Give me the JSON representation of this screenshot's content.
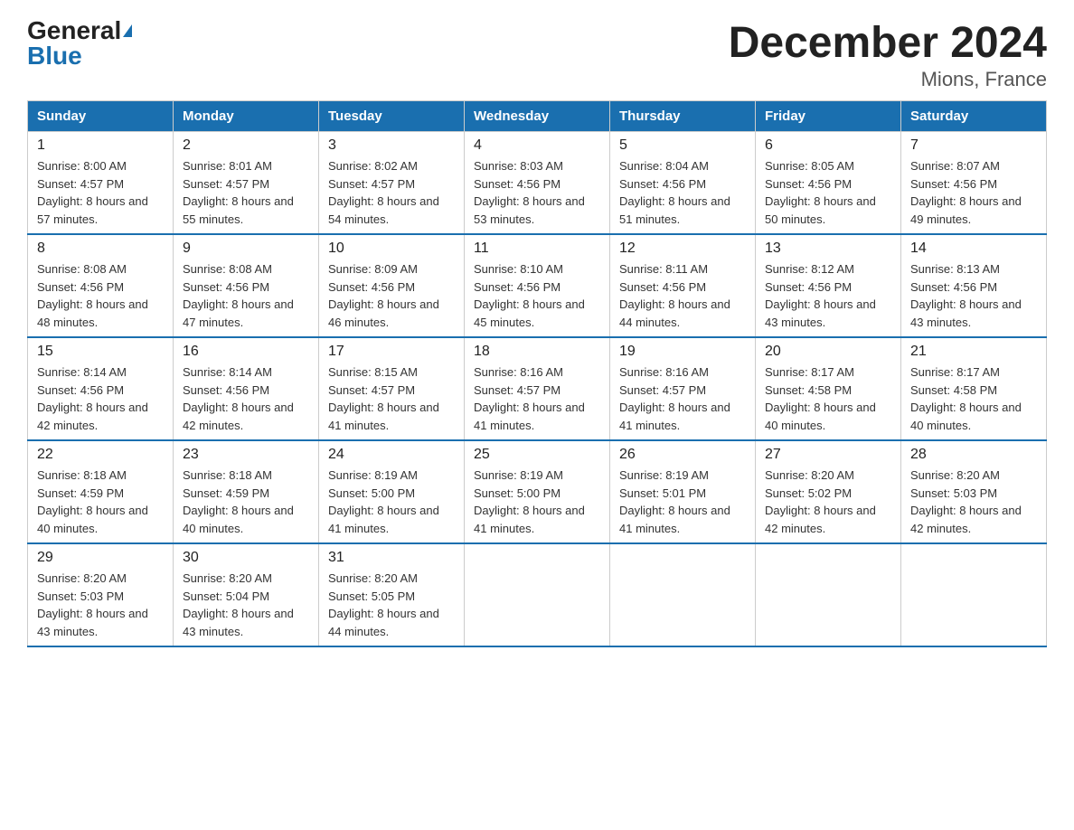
{
  "header": {
    "logo_general": "General",
    "logo_blue": "Blue",
    "month_title": "December 2024",
    "location": "Mions, France"
  },
  "weekdays": [
    "Sunday",
    "Monday",
    "Tuesday",
    "Wednesday",
    "Thursday",
    "Friday",
    "Saturday"
  ],
  "weeks": [
    [
      {
        "day": "1",
        "sunrise": "8:00 AM",
        "sunset": "4:57 PM",
        "daylight": "8 hours and 57 minutes."
      },
      {
        "day": "2",
        "sunrise": "8:01 AM",
        "sunset": "4:57 PM",
        "daylight": "8 hours and 55 minutes."
      },
      {
        "day": "3",
        "sunrise": "8:02 AM",
        "sunset": "4:57 PM",
        "daylight": "8 hours and 54 minutes."
      },
      {
        "day": "4",
        "sunrise": "8:03 AM",
        "sunset": "4:56 PM",
        "daylight": "8 hours and 53 minutes."
      },
      {
        "day": "5",
        "sunrise": "8:04 AM",
        "sunset": "4:56 PM",
        "daylight": "8 hours and 51 minutes."
      },
      {
        "day": "6",
        "sunrise": "8:05 AM",
        "sunset": "4:56 PM",
        "daylight": "8 hours and 50 minutes."
      },
      {
        "day": "7",
        "sunrise": "8:07 AM",
        "sunset": "4:56 PM",
        "daylight": "8 hours and 49 minutes."
      }
    ],
    [
      {
        "day": "8",
        "sunrise": "8:08 AM",
        "sunset": "4:56 PM",
        "daylight": "8 hours and 48 minutes."
      },
      {
        "day": "9",
        "sunrise": "8:08 AM",
        "sunset": "4:56 PM",
        "daylight": "8 hours and 47 minutes."
      },
      {
        "day": "10",
        "sunrise": "8:09 AM",
        "sunset": "4:56 PM",
        "daylight": "8 hours and 46 minutes."
      },
      {
        "day": "11",
        "sunrise": "8:10 AM",
        "sunset": "4:56 PM",
        "daylight": "8 hours and 45 minutes."
      },
      {
        "day": "12",
        "sunrise": "8:11 AM",
        "sunset": "4:56 PM",
        "daylight": "8 hours and 44 minutes."
      },
      {
        "day": "13",
        "sunrise": "8:12 AM",
        "sunset": "4:56 PM",
        "daylight": "8 hours and 43 minutes."
      },
      {
        "day": "14",
        "sunrise": "8:13 AM",
        "sunset": "4:56 PM",
        "daylight": "8 hours and 43 minutes."
      }
    ],
    [
      {
        "day": "15",
        "sunrise": "8:14 AM",
        "sunset": "4:56 PM",
        "daylight": "8 hours and 42 minutes."
      },
      {
        "day": "16",
        "sunrise": "8:14 AM",
        "sunset": "4:56 PM",
        "daylight": "8 hours and 42 minutes."
      },
      {
        "day": "17",
        "sunrise": "8:15 AM",
        "sunset": "4:57 PM",
        "daylight": "8 hours and 41 minutes."
      },
      {
        "day": "18",
        "sunrise": "8:16 AM",
        "sunset": "4:57 PM",
        "daylight": "8 hours and 41 minutes."
      },
      {
        "day": "19",
        "sunrise": "8:16 AM",
        "sunset": "4:57 PM",
        "daylight": "8 hours and 41 minutes."
      },
      {
        "day": "20",
        "sunrise": "8:17 AM",
        "sunset": "4:58 PM",
        "daylight": "8 hours and 40 minutes."
      },
      {
        "day": "21",
        "sunrise": "8:17 AM",
        "sunset": "4:58 PM",
        "daylight": "8 hours and 40 minutes."
      }
    ],
    [
      {
        "day": "22",
        "sunrise": "8:18 AM",
        "sunset": "4:59 PM",
        "daylight": "8 hours and 40 minutes."
      },
      {
        "day": "23",
        "sunrise": "8:18 AM",
        "sunset": "4:59 PM",
        "daylight": "8 hours and 40 minutes."
      },
      {
        "day": "24",
        "sunrise": "8:19 AM",
        "sunset": "5:00 PM",
        "daylight": "8 hours and 41 minutes."
      },
      {
        "day": "25",
        "sunrise": "8:19 AM",
        "sunset": "5:00 PM",
        "daylight": "8 hours and 41 minutes."
      },
      {
        "day": "26",
        "sunrise": "8:19 AM",
        "sunset": "5:01 PM",
        "daylight": "8 hours and 41 minutes."
      },
      {
        "day": "27",
        "sunrise": "8:20 AM",
        "sunset": "5:02 PM",
        "daylight": "8 hours and 42 minutes."
      },
      {
        "day": "28",
        "sunrise": "8:20 AM",
        "sunset": "5:03 PM",
        "daylight": "8 hours and 42 minutes."
      }
    ],
    [
      {
        "day": "29",
        "sunrise": "8:20 AM",
        "sunset": "5:03 PM",
        "daylight": "8 hours and 43 minutes."
      },
      {
        "day": "30",
        "sunrise": "8:20 AM",
        "sunset": "5:04 PM",
        "daylight": "8 hours and 43 minutes."
      },
      {
        "day": "31",
        "sunrise": "8:20 AM",
        "sunset": "5:05 PM",
        "daylight": "8 hours and 44 minutes."
      },
      null,
      null,
      null,
      null
    ]
  ]
}
